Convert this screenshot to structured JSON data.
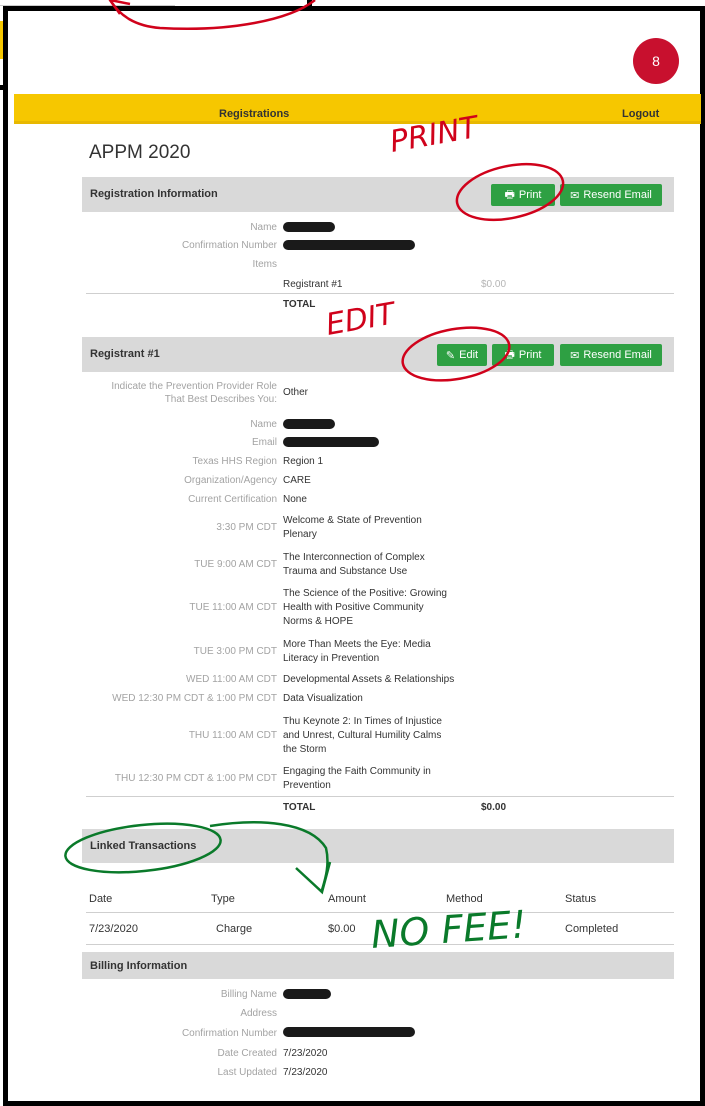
{
  "badge": "8",
  "nav": {
    "registrations": "Registrations",
    "logout": "Logout"
  },
  "title": "APPM 2020",
  "registration_info": {
    "title": "Registration Information",
    "print": "Print",
    "resend": "Resend Email",
    "labels": {
      "name": "Name",
      "confirmation": "Confirmation Number",
      "items": "Items"
    },
    "item_name": "Registrant #1",
    "item_price": "$0.00",
    "total": "TOTAL"
  },
  "registrant": {
    "title": "Registrant #1",
    "edit": "Edit",
    "print": "Print",
    "resend": "Resend Email",
    "role_label_1": "Indicate the Prevention Provider Role",
    "role_label_2": "That Best Describes You:",
    "role_value": "Other",
    "name_label": "Name",
    "email_label": "Email",
    "region_label": "Texas HHS Region",
    "region_value": "Region 1",
    "org_label": "Organization/Agency",
    "org_value": "CARE",
    "cert_label": "Current Certification",
    "cert_value": "None",
    "sessions": [
      {
        "time": "3:30 PM CDT",
        "title": [
          "Welcome & State of Prevention",
          "Plenary"
        ]
      },
      {
        "time": "TUE 9:00 AM CDT",
        "title": [
          "The Interconnection of Complex",
          "Trauma and Substance Use"
        ]
      },
      {
        "time": "TUE 11:00 AM CDT",
        "title": [
          "The Science of the Positive: Growing",
          "Health with Positive Community",
          "Norms & HOPE"
        ]
      },
      {
        "time": "TUE 3:00 PM CDT",
        "title": [
          "More Than Meets the Eye: Media",
          "Literacy in Prevention"
        ]
      },
      {
        "time": "WED 11:00 AM CDT",
        "title": [
          "Developmental Assets & Relationships"
        ]
      },
      {
        "time": "WED 12:30 PM CDT & 1:00 PM CDT",
        "title": [
          "Data Visualization"
        ]
      },
      {
        "time": "THU 11:00 AM CDT",
        "title": [
          "Thu Keynote 2: In Times of Injustice",
          "and Unrest, Cultural Humility Calms",
          "the Storm"
        ]
      },
      {
        "time": "THU 12:30 PM CDT & 1:00 PM CDT",
        "title": [
          "Engaging the Faith Community in",
          "Prevention"
        ]
      }
    ],
    "total": "TOTAL",
    "total_value": "$0.00"
  },
  "linked": {
    "title": "Linked Transactions",
    "headers": [
      "Date",
      "Type",
      "Amount",
      "Method",
      "Status"
    ],
    "row": {
      "date": "7/23/2020",
      "type": "Charge",
      "amount": "$0.00",
      "method": "-",
      "status": "Completed"
    }
  },
  "billing": {
    "title": "Billing Information",
    "labels": {
      "name": "Billing Name",
      "address": "Address",
      "confirmation": "Confirmation Number",
      "created": "Date Created",
      "updated": "Last Updated"
    },
    "created": "7/23/2020",
    "updated": "7/23/2020"
  },
  "annotations": {
    "print": "PRINT",
    "edit": "EDIT",
    "nofee": "NO FEE!"
  },
  "colors": {
    "yellow": "#f6c700",
    "green": "#2ea043",
    "badge": "#c8102e",
    "annot_red": "#d0021b",
    "annot_green": "#0a7a2a"
  }
}
